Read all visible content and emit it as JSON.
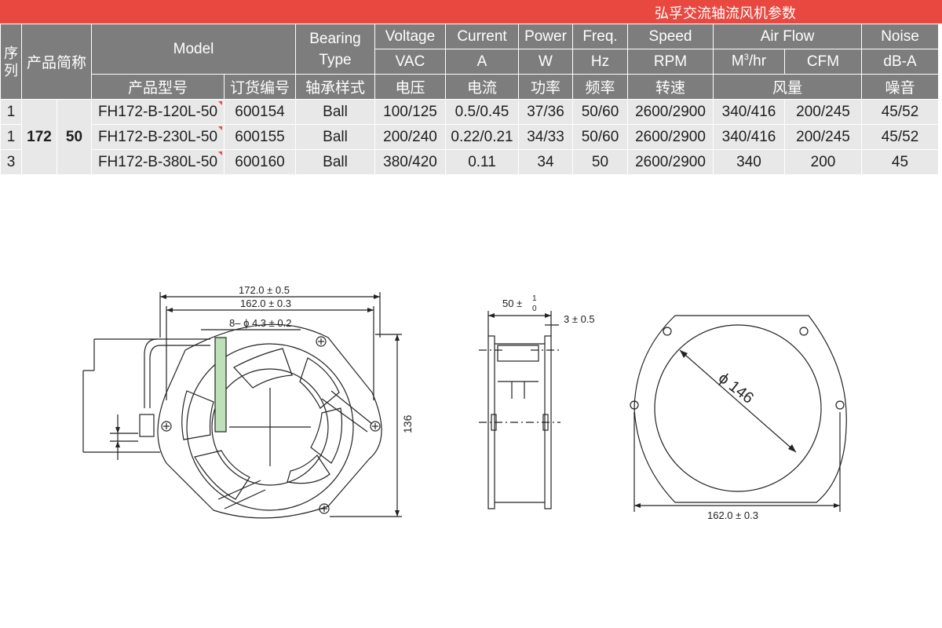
{
  "title": "弘孚交流轴流风机参数",
  "headers": {
    "seq": "序列",
    "short_name": "产品简称",
    "model": "Model",
    "bearing_type": "Bearing Type",
    "voltage": "Voltage",
    "current": "Current",
    "power": "Power",
    "freq": "Freq.",
    "speed": "Speed",
    "airflow": "Air Flow",
    "noise": "Noise",
    "unit_vac": "VAC",
    "unit_a": "A",
    "unit_w": "W",
    "unit_hz": "Hz",
    "unit_rpm": "RPM",
    "unit_m3_base": "M",
    "unit_m3_sup": "3",
    "unit_m3_tail": "/hr",
    "unit_cfm": "CFM",
    "unit_dba": "dB-A",
    "cn_model": "产品型号",
    "cn_order": "订货编号",
    "cn_bearing": "轴承样式",
    "cn_voltage": "电压",
    "cn_current": "电流",
    "cn_power": "功率",
    "cn_freq": "频率",
    "cn_speed": "转速",
    "cn_airflow": "风量",
    "cn_noise": "噪音"
  },
  "short_name": {
    "size": "172",
    "thickness": "50"
  },
  "rows": [
    {
      "seq": "1",
      "model": "FH172-B-120L-50",
      "order": "600154",
      "bearing": "Ball",
      "voltage": "100/125",
      "current": "0.5/0.45",
      "power": "37/36",
      "freq": "50/60",
      "speed": "2600/2900",
      "m3hr": "340/416",
      "cfm": "200/245",
      "noise": "45/52"
    },
    {
      "seq": "1",
      "model": "FH172-B-230L-50",
      "order": "600155",
      "bearing": "Ball",
      "voltage": "200/240",
      "current": "0.22/0.21",
      "power": "34/33",
      "freq": "50/60",
      "speed": "2600/2900",
      "m3hr": "340/416",
      "cfm": "200/245",
      "noise": "45/52"
    },
    {
      "seq": "3",
      "model": "FH172-B-380L-50",
      "order": "600160",
      "bearing": "Ball",
      "voltage": "380/420",
      "current": "0.11",
      "power": "34",
      "freq": "50",
      "speed": "2600/2900",
      "m3hr": "340",
      "cfm": "200",
      "noise": "45"
    }
  ],
  "drawing": {
    "dim_overall_width": "172.0 ± 0.5",
    "dim_hole_pitch": "162.0 ± 0.3",
    "dim_holes": "8– ϕ 4.3 ± 0.2",
    "dim_height": "136",
    "dim_depth_base": "50 ±",
    "dim_depth_tol_upper": "1",
    "dim_depth_tol_lower": "0",
    "dim_flange": "3 ± 0.5",
    "dim_bore": "ϕ 146",
    "dim_bottom_pitch": "162.0 ± 0.3"
  }
}
